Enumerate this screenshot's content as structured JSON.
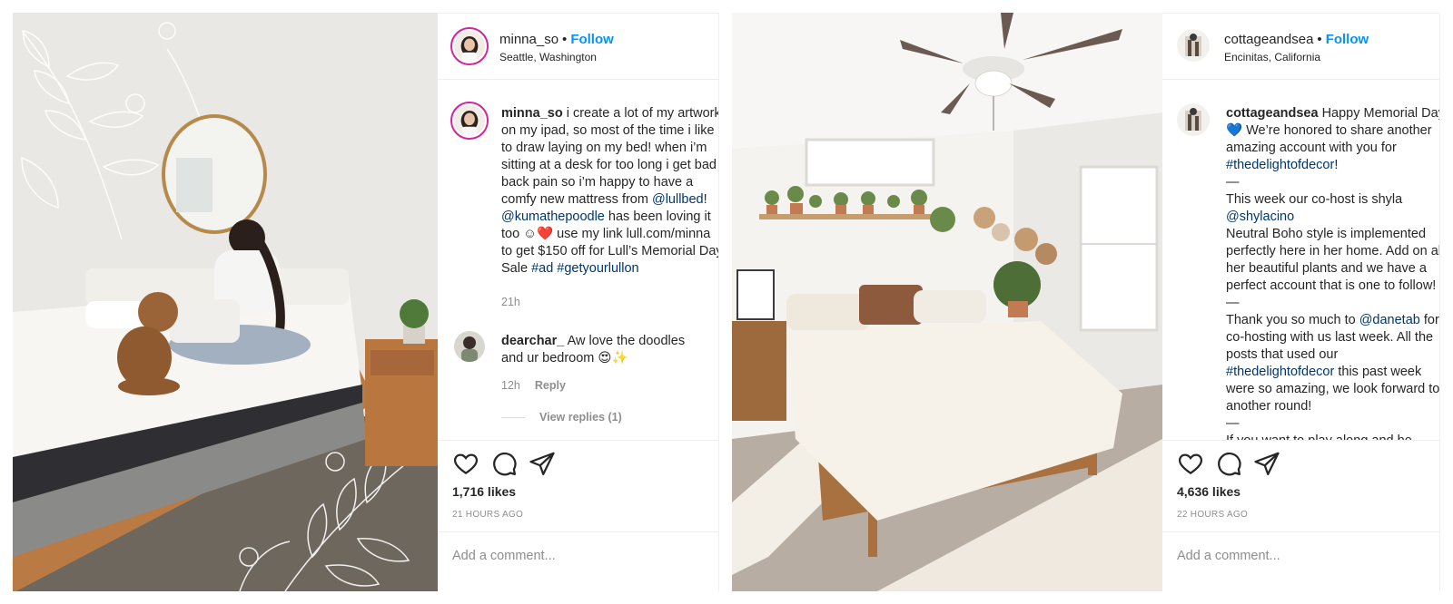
{
  "posts": [
    {
      "username": "minna_so",
      "separator": "•",
      "follow_label": "Follow",
      "location": "Seattle, Washington",
      "caption": {
        "username": "minna_so",
        "lines": [
          "i create a lot of my artwork",
          "on my ipad, so most of the time i like",
          "to draw laying on my bed! when i’m",
          "sitting at a desk for too long i get bad",
          "back pain so i’m happy to have a",
          "comfy new mattress from ",
          "@lullbed",
          "!",
          "@kumathepoodle",
          " has been loving it",
          "too ☺",
          "❤️",
          " use my link lull.com/minna",
          "to get $150 off for Lull’s Memorial Day",
          "Sale ",
          "#ad",
          " ",
          "#getyourlullon"
        ]
      },
      "caption_time": "21h",
      "comments": [
        {
          "username": "dearchar_",
          "text_line1": "Aw love the doodles",
          "text_line2": "and ur bedroom 😍✨",
          "time": "12h",
          "reply_label": "Reply",
          "view_replies": "View replies (1)"
        }
      ],
      "likes": "1,716 likes",
      "time_ago": "21 HOURS AGO",
      "add_comment_placeholder": "Add a comment..."
    },
    {
      "username": "cottageandsea",
      "separator": "•",
      "follow_label": "Follow",
      "location": "Encinitas, California",
      "caption": {
        "username": "cottageandsea",
        "lines": [
          " Happy Memorial Day",
          "💙",
          " We’re honored to share another",
          "amazing account with you for",
          "#thedelightofdecor",
          "!",
          "—",
          "This week our co-host is shyla",
          "@shylacino",
          "Neutral Boho style is implemented",
          "perfectly here in her home. Add on all",
          "her beautiful plants and we have a",
          "perfect account that is one to follow!",
          "—",
          "Thank you so much to ",
          "@danetab",
          " for",
          "co-hosting with us last week. All the",
          "posts that used our",
          "#thedelightofdecor",
          " this past week",
          "were so amazing, we look forward to",
          "another round!",
          "—",
          "If you want to play along and be"
        ]
      },
      "likes": "4,636 likes",
      "time_ago": "22 HOURS AGO",
      "add_comment_placeholder": "Add a comment..."
    }
  ],
  "colors": {
    "link": "#00376b",
    "follow": "#0095f6",
    "muted": "#8e8e8e",
    "text": "#262626",
    "ring": "#d6249f"
  },
  "icons": [
    "heart-icon",
    "comment-icon",
    "share-icon"
  ]
}
